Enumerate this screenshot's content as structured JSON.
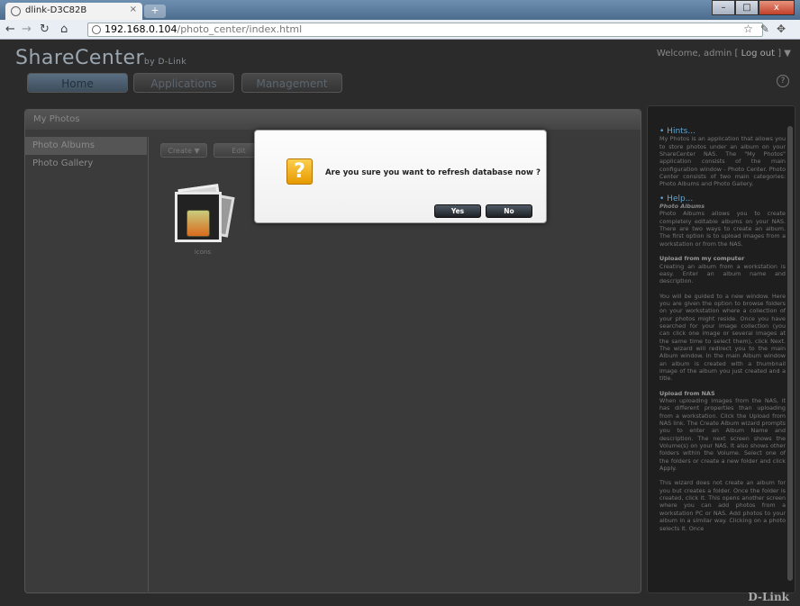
{
  "browser": {
    "tab_title": "dlink-D3C82B",
    "tab_close": "×",
    "new_tab": "+",
    "url_host": "192.168.0.104",
    "url_path": "/photo_center/index.html",
    "window_buttons": {
      "minimize": "–",
      "maximize": "□",
      "close": "x"
    }
  },
  "header": {
    "brand": "ShareCenter",
    "brand_suffix": "by D-Link",
    "welcome": "Welcome, admin [",
    "logout": "Log out",
    "welcome_end": "] ▼",
    "help_icon": "?"
  },
  "nav": {
    "home": "Home",
    "applications": "Applications",
    "management": "Management"
  },
  "panel": {
    "title": "My Photos",
    "left_items": [
      "Photo Albums",
      "Photo Gallery"
    ],
    "create_button": "Create ▼",
    "edit_button": "Edit",
    "album_label": "icons"
  },
  "dialog": {
    "message": "Are you sure you want to refresh database now ?",
    "yes": "Yes",
    "no": "No",
    "icon": "?"
  },
  "hints": {
    "hints_title": "Hints...",
    "hints_text": "My Photos is an application that allows you to store photos under an album on your ShareCenter NAS. The \"My Photos\" application consists of the main configuration window - Photo Center. Photo Center consists of two main categories: Photo Albums and Photo Gallery.",
    "help_title": "Help...",
    "help_sub": "Photo Albums",
    "help_text": "Photo Albums allows you to create completely editable albums on your NAS. There are two ways to create an album. The first option is to upload images from a workstation or from the NAS.",
    "upload_computer_title": "Upload from my computer",
    "upload_computer_text": "Creating an album from a workstation is easy. Enter an album name and description.",
    "guided_text": "You will be guided to a new window. Here you are given the option to browse folders on your workstation where a collection of your photos might reside. Once you have searched for your image collection (you can click one image or several images at the same time to select them), click Next. The wizard will redirect you to the main Album window. In the main Album window an album is created with a thumbnail image of the album you just created and a title.",
    "upload_nas_title": "Upload from NAS",
    "upload_nas_text": "When uploading images from the NAS, it has different properties than uploading from a workstation. Click the Upload from NAS link. The Create Album wizard prompts you to enter an Album Name and description. The next screen shows the Volume(s) on your NAS. It also shows other folders within the Volume. Select one of the folders or create a new folder and click Apply.",
    "wizard_text": "This wizard does not create an album for you but creates a folder. Once the folder is created, click it. This opens another screen where you can add photos from a workstation PC or NAS. Add photos to your album in a similar way. Clicking on a photo selects it. Once"
  },
  "footer_logo": "D-Link"
}
